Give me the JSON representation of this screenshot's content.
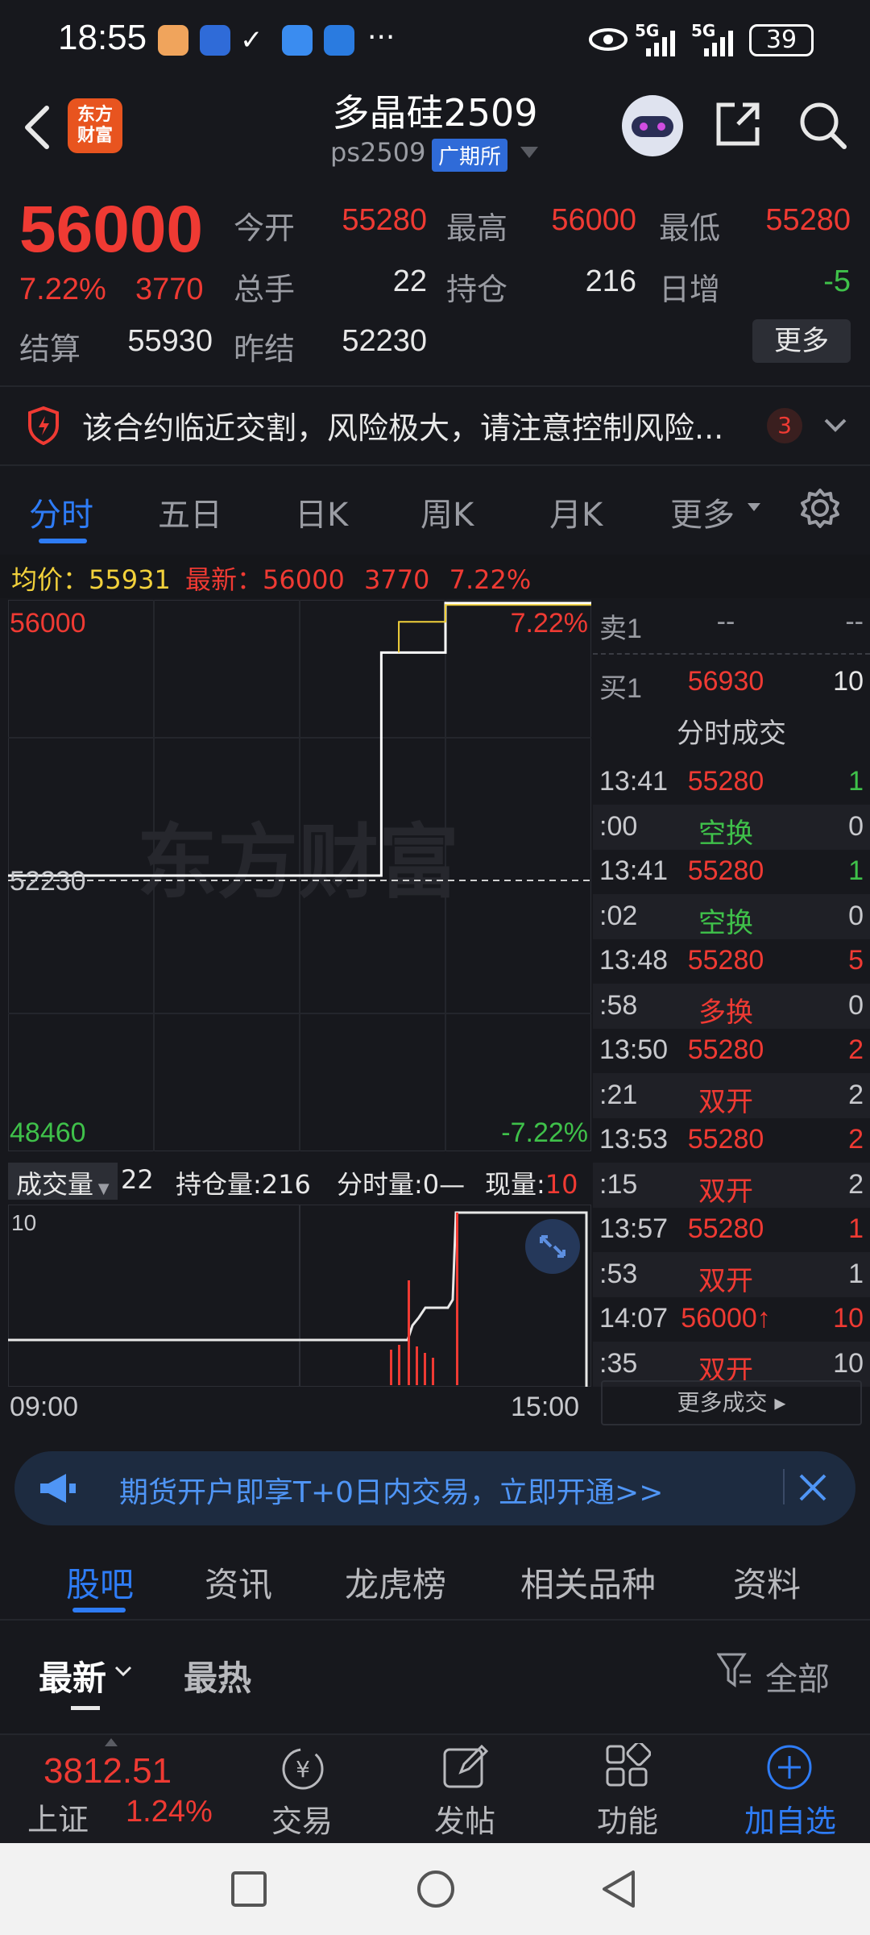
{
  "status_bar": {
    "time": "18:55",
    "more": "···",
    "signal1": "5G",
    "signal2": "5G",
    "battery": "39"
  },
  "header": {
    "logo_text": "东方\n财富",
    "title": "多晶硅2509",
    "code": "ps2509",
    "exchange": "广期所"
  },
  "quote": {
    "price": "56000",
    "change_pct": "7.22%",
    "change_amt": "3770",
    "fields": [
      {
        "label": "今开",
        "value": "55280",
        "color": "red"
      },
      {
        "label": "最高",
        "value": "56000",
        "color": "red"
      },
      {
        "label": "最低",
        "value": "55280",
        "color": "red"
      },
      {
        "label": "总手",
        "value": "22",
        "color": "white"
      },
      {
        "label": "持仓",
        "value": "216",
        "color": "white"
      },
      {
        "label": "日增",
        "value": "-5",
        "color": "green"
      }
    ],
    "settle_label": "结算",
    "settle_value": "55930",
    "prev_settle_label": "昨结",
    "prev_settle_value": "52230",
    "more_label": "更多"
  },
  "risk": {
    "text": "该合约临近交割，风险极大，请注意控制风险...",
    "count": "3"
  },
  "chart_tabs": [
    "分时",
    "五日",
    "日K",
    "周K",
    "月K",
    "更多"
  ],
  "chart_info": {
    "avg_label": "均价：",
    "avg_value": "55931",
    "latest_label": "最新：",
    "latest_value": "56000",
    "latest_change": "3770",
    "latest_pct": "7.22%",
    "watermark": "东方财富"
  },
  "chart_data": {
    "type": "line",
    "title": "",
    "y_top": "56000",
    "y_mid": "52230",
    "y_bottom": "48460",
    "pct_top": "7.22%",
    "pct_bottom": "-7.22%",
    "ylim": [
      48460,
      56000
    ],
    "x_start": "09:00",
    "x_end": "15:00",
    "series": [
      {
        "values_desc": "price",
        "x": [
          0,
          0.64,
          0.64,
          0.75,
          0.75,
          1.0
        ],
        "y": [
          52230,
          52230,
          55280,
          55280,
          56000,
          56000
        ]
      },
      {
        "values_desc": "avg",
        "x": [
          0.67,
          0.67,
          0.75,
          0.75,
          1.0
        ],
        "y": [
          55280,
          55700,
          55700,
          55931,
          55931
        ]
      }
    ],
    "volume": {
      "label": "成交量",
      "total": "22",
      "oi_label": "持仓量:",
      "oi_value": "216",
      "minute_label": "分时量:",
      "minute_value": "0—",
      "current_label": "现量:",
      "current_value": "10",
      "y_top": "10"
    }
  },
  "orderbook": {
    "sell1_label": "卖1",
    "sell1_price": "--",
    "sell1_vol": "--",
    "buy1_label": "买1",
    "buy1_price": "56930",
    "buy1_vol": "10",
    "trades_title": "分时成交",
    "more_trades": "更多成交",
    "rows": [
      {
        "time": "13:41",
        "price": "55280",
        "vol": "1",
        "pc": "red",
        "vc": "green"
      },
      {
        "time": ":00",
        "price": "空换",
        "vol": "0",
        "pc": "green",
        "vc": "gray"
      },
      {
        "time": "13:41",
        "price": "55280",
        "vol": "1",
        "pc": "red",
        "vc": "green"
      },
      {
        "time": ":02",
        "price": "空换",
        "vol": "0",
        "pc": "green",
        "vc": "gray"
      },
      {
        "time": "13:48",
        "price": "55280",
        "vol": "5",
        "pc": "red",
        "vc": "red"
      },
      {
        "time": ":58",
        "price": "多换",
        "vol": "0",
        "pc": "red",
        "vc": "gray"
      },
      {
        "time": "13:50",
        "price": "55280",
        "vol": "2",
        "pc": "red",
        "vc": "red"
      },
      {
        "time": ":21",
        "price": "双开",
        "vol": "2",
        "pc": "red",
        "vc": "gray"
      },
      {
        "time": "13:53",
        "price": "55280",
        "vol": "2",
        "pc": "red",
        "vc": "red"
      },
      {
        "time": ":15",
        "price": "双开",
        "vol": "2",
        "pc": "red",
        "vc": "gray"
      },
      {
        "time": "13:57",
        "price": "55280",
        "vol": "1",
        "pc": "red",
        "vc": "red"
      },
      {
        "time": ":53",
        "price": "双开",
        "vol": "1",
        "pc": "red",
        "vc": "gray"
      },
      {
        "time": "14:07",
        "price": "56000↑",
        "vol": "10",
        "pc": "red",
        "vc": "red"
      },
      {
        "time": ":35",
        "price": "双开",
        "vol": "10",
        "pc": "red",
        "vc": "gray"
      }
    ]
  },
  "promo": {
    "text": "期货开户即享T+0日内交易，立即开通>>"
  },
  "bottom_tabs": [
    "股吧",
    "资讯",
    "龙虎榜",
    "相关品种",
    "资料"
  ],
  "sort": {
    "latest": "最新",
    "hot": "最热",
    "filter": "全部"
  },
  "bottom_bar": {
    "index_value": "3812.51",
    "index_name": "上证",
    "index_pct": "1.24%",
    "items": [
      "交易",
      "发帖",
      "功能",
      "加自选"
    ]
  },
  "colors": {
    "red": "#ef3a33",
    "green": "#3fc14a",
    "blue": "#2e7cf6",
    "bg": "#17181d"
  }
}
